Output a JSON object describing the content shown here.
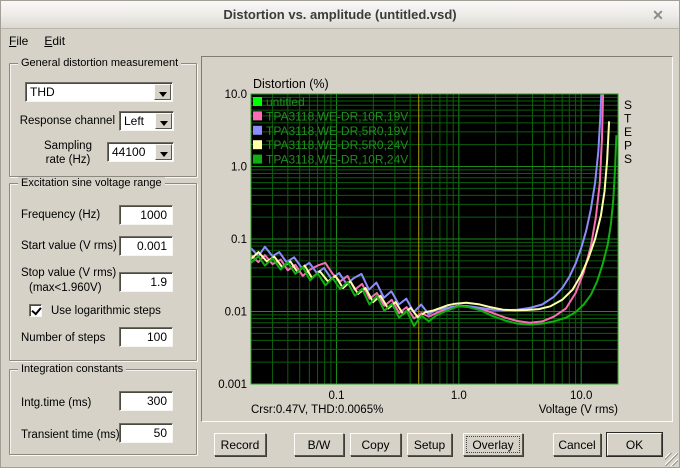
{
  "window": {
    "title": "Distortion vs. amplitude (untitled.vsd)",
    "close_glyph": "✕"
  },
  "menu": {
    "items": [
      "File",
      "Edit"
    ]
  },
  "general": {
    "title": "General distortion measurement",
    "measurement_value": "THD",
    "response_channel_label": "Response channel",
    "response_channel_value": "Left",
    "sampling_label_line1": "Sampling",
    "sampling_label_line2": "rate (Hz)",
    "sampling_value": "44100"
  },
  "excitation": {
    "title": "Excitation sine voltage range",
    "frequency_label": "Frequency (Hz)",
    "frequency_value": "1000",
    "start_label": "Start value (V rms)",
    "start_value": "0.001",
    "stop_label": "Stop value (V rms)",
    "stop_sublabel": "(max<1.960V)",
    "stop_value": "1.9",
    "log_steps_label": "Use logarithmic steps",
    "log_steps_checked": true,
    "steps_label": "Number of steps",
    "steps_value": "100"
  },
  "integration": {
    "title": "Integration constants",
    "intg_label": "Intg.time (ms)",
    "intg_value": "300",
    "transient_label": "Transient time (ms)",
    "transient_value": "50"
  },
  "buttons": {
    "record": "Record",
    "bw": "B/W",
    "copy": "Copy",
    "setup": "Setup",
    "overlay": "Overlay",
    "cancel": "Cancel",
    "ok": "OK"
  },
  "chart_data": {
    "type": "line",
    "title": "Distortion (%)",
    "xlabel": "Voltage (V rms)",
    "side_label": "STEPS",
    "x_scale": "log",
    "y_scale": "log",
    "xlim": [
      0.02,
      20
    ],
    "ylim": [
      0.001,
      10
    ],
    "x_ticks": [
      {
        "v": 0.1,
        "label": "0.1"
      },
      {
        "v": 1,
        "label": "1.0"
      },
      {
        "v": 10,
        "label": "10.0"
      }
    ],
    "y_ticks": [
      {
        "v": 10,
        "label": "10.0"
      },
      {
        "v": 1,
        "label": "1.0"
      },
      {
        "v": 0.1,
        "label": "0.1"
      },
      {
        "v": 0.01,
        "label": "0.01"
      },
      {
        "v": 0.001,
        "label": "0.001"
      }
    ],
    "cursor": {
      "x": 0.47,
      "text": "Crsr:0.47V, THD:0.0065%",
      "color": "#ADA000"
    },
    "colors": {
      "plot_bg": "#000000",
      "grid_minor": "#0C5E0C",
      "grid_major": "#1B8A1B",
      "plot_border": "#25A325",
      "legend_text": "#1E8E1E",
      "axis_text": "#000000"
    },
    "series": [
      {
        "name": "untitled",
        "color": "#00FF00",
        "points": []
      },
      {
        "name": "TPA3118,WE-DR,10R,19V",
        "color": "#FA6CB4",
        "points": [
          [
            0.02,
            0.06
          ],
          [
            0.023,
            0.048
          ],
          [
            0.026,
            0.06
          ],
          [
            0.03,
            0.045
          ],
          [
            0.035,
            0.052
          ],
          [
            0.04,
            0.037
          ],
          [
            0.046,
            0.044
          ],
          [
            0.053,
            0.031
          ],
          [
            0.061,
            0.038
          ],
          [
            0.07,
            0.043
          ],
          [
            0.081,
            0.047
          ],
          [
            0.093,
            0.033
          ],
          [
            0.107,
            0.026
          ],
          [
            0.123,
            0.031
          ],
          [
            0.141,
            0.02
          ],
          [
            0.162,
            0.024
          ],
          [
            0.186,
            0.015
          ],
          [
            0.214,
            0.018
          ],
          [
            0.246,
            0.012
          ],
          [
            0.283,
            0.0145
          ],
          [
            0.325,
            0.0095
          ],
          [
            0.374,
            0.0115
          ],
          [
            0.43,
            0.008
          ],
          [
            0.494,
            0.0095
          ],
          [
            0.568,
            0.0085
          ],
          [
            0.653,
            0.0095
          ],
          [
            0.751,
            0.0105
          ],
          [
            0.864,
            0.0115
          ],
          [
            0.993,
            0.012
          ],
          [
            1.2,
            0.0118
          ],
          [
            1.5,
            0.011
          ],
          [
            1.9,
            0.0095
          ],
          [
            2.4,
            0.0082
          ],
          [
            3.0,
            0.0074
          ],
          [
            3.8,
            0.007
          ],
          [
            4.8,
            0.0073
          ],
          [
            6.0,
            0.0085
          ],
          [
            7.5,
            0.011
          ],
          [
            9.0,
            0.018
          ],
          [
            10.5,
            0.035
          ],
          [
            12.0,
            0.08
          ],
          [
            13.2,
            0.2
          ],
          [
            14.2,
            0.6
          ],
          [
            14.8,
            2.5
          ],
          [
            15.1,
            10
          ]
        ]
      },
      {
        "name": "TPA3118,WE-DR,5R0,19V",
        "color": "#8C8CFC",
        "points": [
          [
            0.02,
            0.075
          ],
          [
            0.023,
            0.058
          ],
          [
            0.026,
            0.078
          ],
          [
            0.03,
            0.058
          ],
          [
            0.034,
            0.066
          ],
          [
            0.039,
            0.048
          ],
          [
            0.045,
            0.056
          ],
          [
            0.052,
            0.04
          ],
          [
            0.06,
            0.047
          ],
          [
            0.069,
            0.034
          ],
          [
            0.079,
            0.04
          ],
          [
            0.091,
            0.028
          ],
          [
            0.105,
            0.034
          ],
          [
            0.121,
            0.024
          ],
          [
            0.139,
            0.029
          ],
          [
            0.16,
            0.033
          ],
          [
            0.184,
            0.02
          ],
          [
            0.212,
            0.025
          ],
          [
            0.244,
            0.0155
          ],
          [
            0.281,
            0.019
          ],
          [
            0.323,
            0.0125
          ],
          [
            0.372,
            0.015
          ],
          [
            0.428,
            0.0098
          ],
          [
            0.492,
            0.0125
          ],
          [
            0.566,
            0.0092
          ],
          [
            0.651,
            0.0105
          ],
          [
            0.749,
            0.011
          ],
          [
            0.862,
            0.0115
          ],
          [
            0.991,
            0.012
          ],
          [
            1.2,
            0.0118
          ],
          [
            1.5,
            0.0112
          ],
          [
            1.9,
            0.0106
          ],
          [
            2.4,
            0.0104
          ],
          [
            3.0,
            0.0106
          ],
          [
            3.8,
            0.0112
          ],
          [
            4.8,
            0.0125
          ],
          [
            6.0,
            0.016
          ],
          [
            7.0,
            0.021
          ],
          [
            8.0,
            0.03
          ],
          [
            9.0,
            0.046
          ],
          [
            10.0,
            0.075
          ],
          [
            11.0,
            0.13
          ],
          [
            12.0,
            0.26
          ],
          [
            13.0,
            0.6
          ],
          [
            13.8,
            1.6
          ],
          [
            14.3,
            4.5
          ],
          [
            14.6,
            10
          ]
        ]
      },
      {
        "name": "TPA3118,WE-DR,5R0,24V",
        "color": "#FFFFA8",
        "points": [
          [
            0.02,
            0.053
          ],
          [
            0.023,
            0.066
          ],
          [
            0.027,
            0.049
          ],
          [
            0.031,
            0.057
          ],
          [
            0.036,
            0.041
          ],
          [
            0.042,
            0.049
          ],
          [
            0.048,
            0.035
          ],
          [
            0.055,
            0.043
          ],
          [
            0.063,
            0.029
          ],
          [
            0.073,
            0.036
          ],
          [
            0.085,
            0.026
          ],
          [
            0.098,
            0.031
          ],
          [
            0.113,
            0.021
          ],
          [
            0.13,
            0.026
          ],
          [
            0.15,
            0.0175
          ],
          [
            0.173,
            0.021
          ],
          [
            0.199,
            0.0135
          ],
          [
            0.229,
            0.0165
          ],
          [
            0.264,
            0.011
          ],
          [
            0.304,
            0.0135
          ],
          [
            0.35,
            0.0092
          ],
          [
            0.403,
            0.0112
          ],
          [
            0.464,
            0.0083
          ],
          [
            0.534,
            0.0098
          ],
          [
            0.615,
            0.0103
          ],
          [
            0.708,
            0.0112
          ],
          [
            0.815,
            0.0122
          ],
          [
            0.938,
            0.0128
          ],
          [
            1.15,
            0.0132
          ],
          [
            1.45,
            0.0126
          ],
          [
            1.8,
            0.0115
          ],
          [
            2.3,
            0.0106
          ],
          [
            2.9,
            0.0104
          ],
          [
            3.6,
            0.0105
          ],
          [
            4.5,
            0.0108
          ],
          [
            5.6,
            0.0118
          ],
          [
            7.0,
            0.0145
          ],
          [
            8.5,
            0.02
          ],
          [
            10.0,
            0.032
          ],
          [
            11.5,
            0.055
          ],
          [
            13.0,
            0.1
          ],
          [
            14.5,
            0.21
          ],
          [
            15.5,
            0.45
          ],
          [
            16.3,
            1.2
          ],
          [
            16.9,
            4.2
          ]
        ]
      },
      {
        "name": "TPA3118,WE-DR,10R,24V",
        "color": "#0FAF0F",
        "points": [
          [
            0.02,
            0.047
          ],
          [
            0.023,
            0.058
          ],
          [
            0.026,
            0.043
          ],
          [
            0.03,
            0.054
          ],
          [
            0.035,
            0.038
          ],
          [
            0.04,
            0.048
          ],
          [
            0.046,
            0.033
          ],
          [
            0.053,
            0.041
          ],
          [
            0.061,
            0.027
          ],
          [
            0.07,
            0.034
          ],
          [
            0.081,
            0.023
          ],
          [
            0.093,
            0.029
          ],
          [
            0.107,
            0.0205
          ],
          [
            0.123,
            0.0255
          ],
          [
            0.141,
            0.0165
          ],
          [
            0.162,
            0.0205
          ],
          [
            0.186,
            0.0125
          ],
          [
            0.214,
            0.0165
          ],
          [
            0.246,
            0.0102
          ],
          [
            0.283,
            0.0128
          ],
          [
            0.325,
            0.0082
          ],
          [
            0.374,
            0.0103
          ],
          [
            0.43,
            0.0063
          ],
          [
            0.494,
            0.0088
          ],
          [
            0.568,
            0.0073
          ],
          [
            0.653,
            0.0088
          ],
          [
            0.751,
            0.0098
          ],
          [
            0.864,
            0.0108
          ],
          [
            0.993,
            0.0118
          ],
          [
            1.2,
            0.0115
          ],
          [
            1.5,
            0.0104
          ],
          [
            1.9,
            0.0086
          ],
          [
            2.4,
            0.0075
          ],
          [
            3.0,
            0.0068
          ],
          [
            3.8,
            0.0066
          ],
          [
            4.8,
            0.0068
          ],
          [
            6.0,
            0.0073
          ],
          [
            7.5,
            0.0082
          ],
          [
            9.0,
            0.0098
          ],
          [
            10.5,
            0.0125
          ],
          [
            12.0,
            0.017
          ],
          [
            13.5,
            0.026
          ],
          [
            15.0,
            0.045
          ],
          [
            16.5,
            0.085
          ],
          [
            17.5,
            0.16
          ],
          [
            18.3,
            0.35
          ],
          [
            18.9,
            0.9
          ],
          [
            19.4,
            2.7
          ]
        ]
      }
    ],
    "legend_position": "top-left"
  }
}
